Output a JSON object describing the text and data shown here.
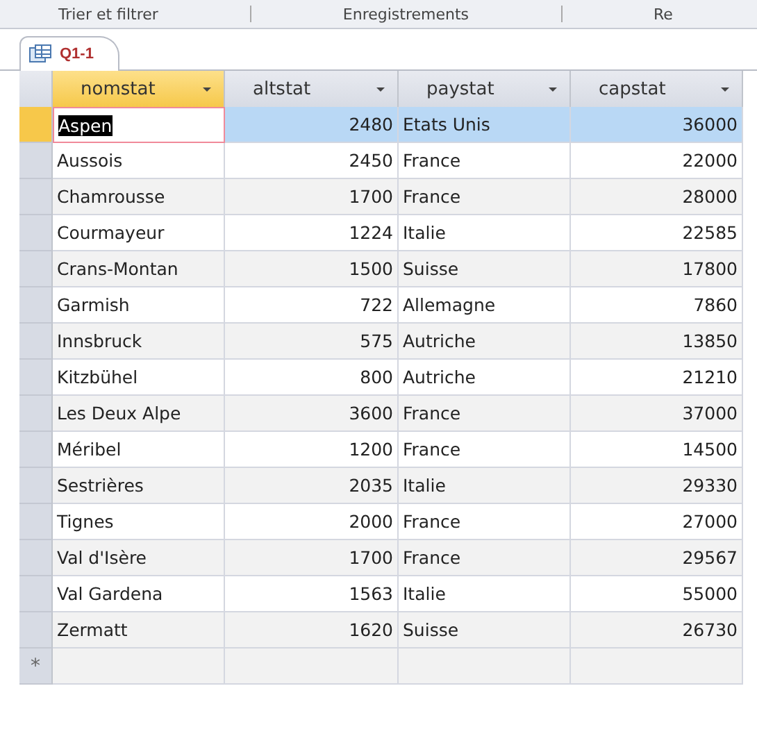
{
  "ribbon": {
    "groups": [
      "Trier et filtrer",
      "Enregistrements",
      "Re"
    ]
  },
  "tab": {
    "label": "Q1-1"
  },
  "table": {
    "columns": [
      {
        "label": "nomstat",
        "kind": "text",
        "selected": true
      },
      {
        "label": "altstat",
        "kind": "number",
        "selected": false
      },
      {
        "label": "paystat",
        "kind": "text",
        "selected": false
      },
      {
        "label": "capstat",
        "kind": "number",
        "selected": false
      }
    ],
    "rows": [
      {
        "cells": [
          "Aspen",
          "2480",
          "Etats Unis",
          "36000"
        ],
        "selected": true
      },
      {
        "cells": [
          "Aussois",
          "2450",
          "France",
          "22000"
        ],
        "selected": false
      },
      {
        "cells": [
          "Chamrousse",
          "1700",
          "France",
          "28000"
        ],
        "selected": false
      },
      {
        "cells": [
          "Courmayeur",
          "1224",
          "Italie",
          "22585"
        ],
        "selected": false
      },
      {
        "cells": [
          "Crans-Montan",
          "1500",
          "Suisse",
          "17800"
        ],
        "selected": false
      },
      {
        "cells": [
          "Garmish",
          "722",
          "Allemagne",
          "7860"
        ],
        "selected": false
      },
      {
        "cells": [
          "Innsbruck",
          "575",
          "Autriche",
          "13850"
        ],
        "selected": false
      },
      {
        "cells": [
          "Kitzbühel",
          "800",
          "Autriche",
          "21210"
        ],
        "selected": false
      },
      {
        "cells": [
          "Les Deux Alpe",
          "3600",
          "France",
          "37000"
        ],
        "selected": false
      },
      {
        "cells": [
          "Méribel",
          "1200",
          "France",
          "14500"
        ],
        "selected": false
      },
      {
        "cells": [
          "Sestrières",
          "2035",
          "Italie",
          "29330"
        ],
        "selected": false
      },
      {
        "cells": [
          "Tignes",
          "2000",
          "France",
          "27000"
        ],
        "selected": false
      },
      {
        "cells": [
          "Val d'Isère",
          "1700",
          "France",
          "29567"
        ],
        "selected": false
      },
      {
        "cells": [
          "Val Gardena",
          "1563",
          "Italie",
          "55000"
        ],
        "selected": false
      },
      {
        "cells": [
          "Zermatt",
          "1620",
          "Suisse",
          "26730"
        ],
        "selected": false
      }
    ],
    "new_row_marker": "*"
  }
}
